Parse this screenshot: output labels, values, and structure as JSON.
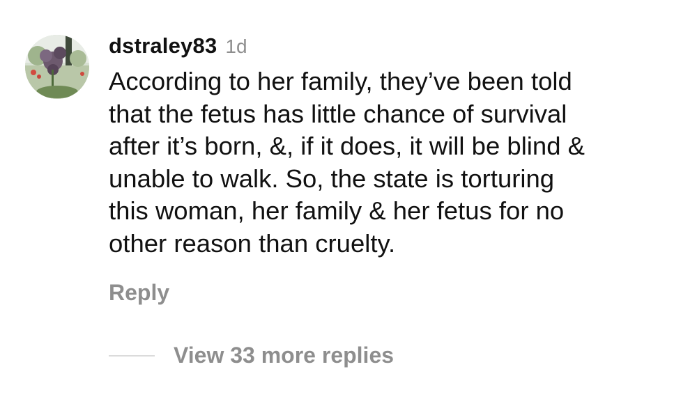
{
  "comment": {
    "username": "dstraley83",
    "timestamp": "1d",
    "text_lines": [
      "According to her family, they’ve been told",
      "that the fetus has little chance of survival",
      "after it’s born, &, if it does, it will be blind &",
      "unable to walk. So, the state is torturing",
      "this woman, her family & her fetus for no",
      "other reason than cruelty."
    ],
    "reply_label": "Reply",
    "view_replies_label": "View 33 more replies"
  },
  "colors": {
    "primary_text": "#111111",
    "secondary_text": "#8e8e8e",
    "divider": "#dbdbdb"
  }
}
